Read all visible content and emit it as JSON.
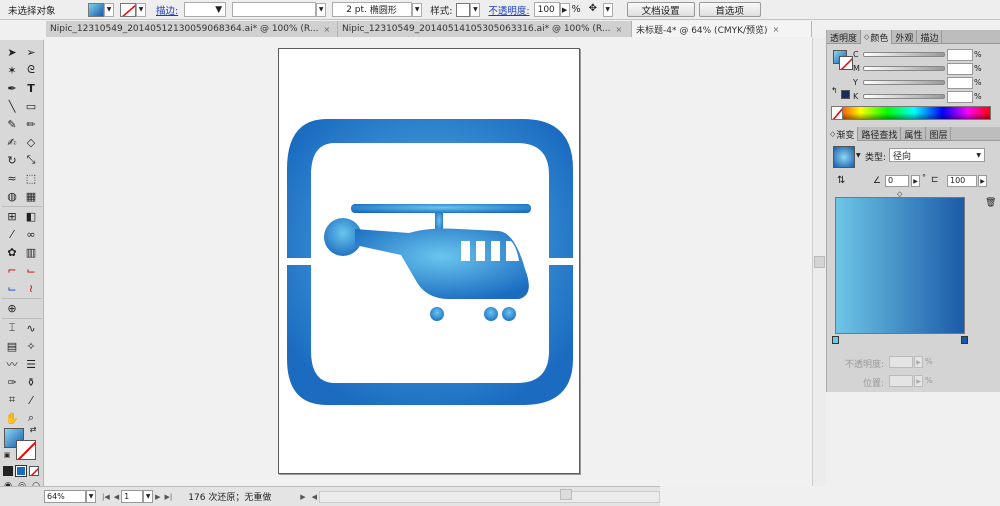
{
  "control_bar": {
    "selection_status": "未选择对象",
    "stroke_label": "描边:",
    "brush_size": "2 pt.",
    "brush_shape": "椭圆形",
    "style_label": "样式:",
    "opacity_label": "不透明度:",
    "opacity_value": "100",
    "percent": "%",
    "doc_setup_button": "文档设置",
    "prefs_button": "首选项"
  },
  "tabs": [
    {
      "label": "Nipic_12310549_20140512130059068364.ai* @ 100% (R...",
      "close": "×"
    },
    {
      "label": "Nipic_12310549_20140514105305063316.ai* @ 100% (R...",
      "close": "×"
    },
    {
      "label": "未标题-4* @ 64% (CMYK/预览)",
      "close": "×"
    }
  ],
  "status_bar": {
    "zoom": "64%",
    "artboard_number": "1",
    "undo_status": "176 次还原；无重做"
  },
  "color_panel": {
    "tabs": [
      "透明度",
      "颜色",
      "外观",
      "描边"
    ],
    "active_tab": "颜色",
    "channels": [
      {
        "label": "C",
        "value": ""
      },
      {
        "label": "M",
        "value": ""
      },
      {
        "label": "Y",
        "value": ""
      },
      {
        "label": "K",
        "value": ""
      }
    ],
    "percent": "%"
  },
  "gradient_panel": {
    "tabs": [
      "渐变",
      "路径查找",
      "属性",
      "图层"
    ],
    "active_tab": "渐变",
    "type_label": "类型:",
    "type_value": "径向",
    "angle_value": "0",
    "aspect_value": "100",
    "opacity_label": "不透明度:",
    "location_label": "位置:",
    "percent": "%",
    "color_start": "#6ec6e6",
    "color_end": "#1b5aa8"
  },
  "artwork": {
    "primary_color": "#1b6cc1",
    "highlight_color": "#5fb8e8"
  }
}
